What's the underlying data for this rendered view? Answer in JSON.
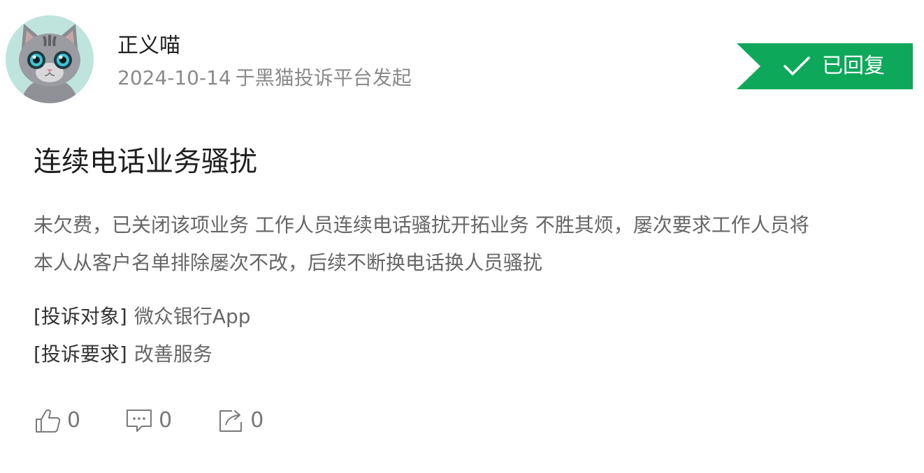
{
  "author": {
    "avatar_icon": "cat-avatar-icon",
    "username": "正义喵",
    "date": "2024-10-14",
    "platform_text": "于黑猫投诉平台发起"
  },
  "status": {
    "icon": "check-icon",
    "label": "已回复",
    "color": "#0ea85b"
  },
  "complaint": {
    "title": "连续电话业务骚扰",
    "body_lines": [
      "未欠费，已关闭该项业务 工作人员连续电话骚扰开拓业务 不胜其烦，屡次要求工作人员将",
      "本人从客户名单排除屡次不改，后续不断换电话换人员骚扰"
    ],
    "target_label": "[投诉对象]",
    "target_value": "微众银行App",
    "request_label": "[投诉要求]",
    "request_value": "改善服务"
  },
  "actions": {
    "like": {
      "icon": "thumbs-up-icon",
      "count": "0"
    },
    "comment": {
      "icon": "comment-icon",
      "count": "0"
    },
    "share": {
      "icon": "share-icon",
      "count": "0"
    }
  }
}
